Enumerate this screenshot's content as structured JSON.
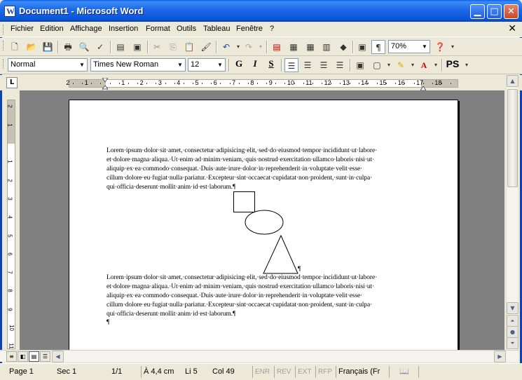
{
  "window": {
    "title": "Document1 - Microsoft Word"
  },
  "menu": {
    "items": [
      "Fichier",
      "Edition",
      "Affichage",
      "Insertion",
      "Format",
      "Outils",
      "Tableau",
      "Fenêtre",
      "?"
    ]
  },
  "format_bar": {
    "style": "Normal",
    "font": "Times New Roman",
    "size": "12",
    "bold": "G",
    "italic": "I",
    "underline": "S",
    "ps": "PS"
  },
  "standard_bar": {
    "zoom": "70%"
  },
  "ruler": {
    "h_labels": [
      "2",
      "1",
      "1",
      "2",
      "3",
      "4",
      "5",
      "6",
      "7",
      "8",
      "9",
      "10",
      "11",
      "12",
      "13",
      "14",
      "15",
      "16",
      "17",
      "18"
    ],
    "v_labels": [
      "2",
      "1",
      "1",
      "2",
      "3",
      "4",
      "5",
      "6",
      "7",
      "8",
      "9",
      "10",
      "11"
    ]
  },
  "document": {
    "paragraph1": [
      "Lorem·ipsum·dolor·sit·amet,·consectetur·adipisicing·elit,·sed·do·eiusmod·tempor·incididunt·ut·labore·",
      "et·dolore·magna·aliqua.·Ut·enim·ad·minim·veniam,·quis·nostrud·exercitation·ullamco·laboris·nisi·ut·",
      "aliquip·ex·ea·commodo·consequat.·Duis·aute·irure·dolor·in·reprehenderit·in·voluptate·velit·esse·",
      "cillum·dolore·eu·fugiat·nulla·pariatur.·Excepteur·sint·occaecat·cupidatat·non·proident,·sunt·in·culpa·",
      "qui·officia·deserunt·mollit·anim·id·est·laborum.¶"
    ],
    "paragraph2": [
      "Lorem·ipsum·dolor·sit·amet,·consectetur·adipisicing·elit,·sed·do·eiusmod·tempor·incididunt·ut·labore·",
      "et·dolore·magna·aliqua.·Ut·enim·ad·minim·veniam,·quis·nostrud·exercitation·ullamco·laboris·nisi·ut·",
      "aliquip·ex·ea·commodo·consequat.·Duis·aute·irure·dolor·in·reprehenderit·in·voluptate·velit·esse·",
      "cillum·dolore·eu·fugiat·nulla·pariatur.·Excepteur·sint·occaecat·cupidatat·non·proident,·sunt·in·culpa·",
      "qui·officia·deserunt·mollit·anim·id·est·laborum.¶"
    ],
    "shape_pilcrow": "¶",
    "end_pilcrow": "¶"
  },
  "status": {
    "page": "Page  1",
    "section": "Sec  1",
    "pages": "1/1",
    "at": "À  4,4 cm",
    "line": "Li  5",
    "col": "Col  49",
    "rec": "ENR",
    "rev": "REV",
    "ext": "EXT",
    "ovr": "RFP",
    "lang": "Français (Fr"
  },
  "colors": {
    "titlebar": "#0a55d9",
    "chrome": "#ece9d8",
    "workspace": "#808080"
  }
}
